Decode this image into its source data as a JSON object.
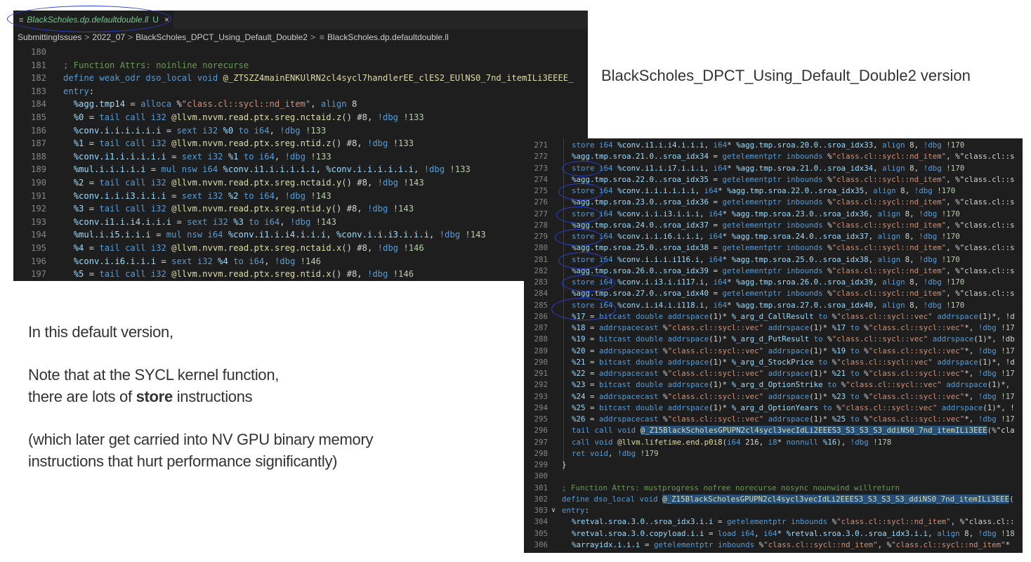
{
  "editor_top": {
    "tab": {
      "filename": "BlackScholes.dp.defaultdouble.ll",
      "status": "U",
      "close": "×"
    },
    "breadcrumb": [
      "SubmittingIssues",
      "2022_07",
      "BlackScholes_DPCT_Using_Default_Double2",
      "BlackScholes.dp.defaultdouble.ll"
    ],
    "lines": [
      {
        "n": "180",
        "t": ""
      },
      {
        "n": "181",
        "t": "; Function Attrs: noinline norecurse"
      },
      {
        "n": "182",
        "t": "define weak_odr dso_local void @_ZTSZZ4mainENKUlRN2cl4sycl7handlerEE_clES2_EUlNS0_7nd_itemILi3EEEE_"
      },
      {
        "n": "183",
        "t": "entry:"
      },
      {
        "n": "184",
        "t": "  %agg.tmp14 = alloca %\"class.cl::sycl::nd_item\", align 8"
      },
      {
        "n": "185",
        "t": "  %0 = tail call i32 @llvm.nvvm.read.ptx.sreg.nctaid.z() #8, !dbg !133"
      },
      {
        "n": "186",
        "t": "  %conv.i.i.i.i.i.i = sext i32 %0 to i64, !dbg !133"
      },
      {
        "n": "187",
        "t": "  %1 = tail call i32 @llvm.nvvm.read.ptx.sreg.ntid.z() #8, !dbg !133"
      },
      {
        "n": "188",
        "t": "  %conv.i1.i.i.i.i.i = sext i32 %1 to i64, !dbg !133"
      },
      {
        "n": "189",
        "t": "  %mul.i.i.i.i.i = mul nsw i64 %conv.i1.i.i.i.i.i, %conv.i.i.i.i.i.i, !dbg !133"
      },
      {
        "n": "190",
        "t": "  %2 = tail call i32 @llvm.nvvm.read.ptx.sreg.nctaid.y() #8, !dbg !143"
      },
      {
        "n": "191",
        "t": "  %conv.i.i.i3.i.i.i = sext i32 %2 to i64, !dbg !143"
      },
      {
        "n": "192",
        "t": "  %3 = tail call i32 @llvm.nvvm.read.ptx.sreg.ntid.y() #8, !dbg !143"
      },
      {
        "n": "193",
        "t": "  %conv.i1.i.i4.i.i.i = sext i32 %3 to i64, !dbg !143"
      },
      {
        "n": "194",
        "t": "  %mul.i.i5.i.i.i = mul nsw i64 %conv.i1.i.i4.i.i.i, %conv.i.i.i3.i.i.i, !dbg !143"
      },
      {
        "n": "195",
        "t": "  %4 = tail call i32 @llvm.nvvm.read.ptx.sreg.nctaid.x() #8, !dbg !146"
      },
      {
        "n": "196",
        "t": "  %conv.i.i6.i.i.i = sext i32 %4 to i64, !dbg !146"
      },
      {
        "n": "197",
        "t": "  %5 = tail call i32 @llvm.nvvm.read.ptx.sreg.ntid.x() #8, !dbg !146"
      }
    ]
  },
  "version_label": "BlackScholes_DPCT_Using_Default_Double2 version",
  "description": {
    "line1": "In this default version,",
    "line2": "Note that at the SYCL kernel function,",
    "line3_pre": "there are lots of ",
    "line3_bold": "store",
    "line3_post": " instructions",
    "line4": "(which later get carried into NV GPU binary memory",
    "line5": "instructions that hurt performance significantly)"
  },
  "editor_bottom": {
    "lines": [
      {
        "n": "271",
        "t": "  store i64 %conv.i1.i.i4.i.i.i, i64* %agg.tmp.sroa.20.0..sroa_idx33, align 8, !dbg !170"
      },
      {
        "n": "272",
        "t": "  %agg.tmp.sroa.21.0..sroa_idx34 = getelementptr inbounds %\"class.cl::sycl::nd_item\", %\"class.cl::s"
      },
      {
        "n": "273",
        "t": "  store i64 %conv.i1.i.i7.i.i.i, i64* %agg.tmp.sroa.21.0..sroa_idx34, align 8, !dbg !170"
      },
      {
        "n": "274",
        "t": "  %agg.tmp.sroa.22.0..sroa_idx35 = getelementptr inbounds %\"class.cl::sycl::nd_item\", %\"class.cl::s"
      },
      {
        "n": "275",
        "t": "  store i64 %conv.i.i.i.i.i.i, i64* %agg.tmp.sroa.22.0..sroa_idx35, align 8, !dbg !170"
      },
      {
        "n": "276",
        "t": "  %agg.tmp.sroa.23.0..sroa_idx36 = getelementptr inbounds %\"class.cl::sycl::nd_item\", %\"class.cl::s"
      },
      {
        "n": "277",
        "t": "  store i64 %conv.i.i.i3.i.i.i, i64* %agg.tmp.sroa.23.0..sroa_idx36, align 8, !dbg !170"
      },
      {
        "n": "278",
        "t": "  %agg.tmp.sroa.24.0..sroa_idx37 = getelementptr inbounds %\"class.cl::sycl::nd_item\", %\"class.cl::s"
      },
      {
        "n": "279",
        "t": "  store i64 %conv.i.i.i6.i.i.i, i64* %agg.tmp.sroa.24.0..sroa_idx37, align 8, !dbg !170"
      },
      {
        "n": "280",
        "t": "  %agg.tmp.sroa.25.0..sroa_idx38 = getelementptr inbounds %\"class.cl::sycl::nd_item\", %\"class.cl::s"
      },
      {
        "n": "281",
        "t": "  store i64 %conv.i.i.i.i116.i, i64* %agg.tmp.sroa.25.0..sroa_idx38, align 8, !dbg !170"
      },
      {
        "n": "282",
        "t": "  %agg.tmp.sroa.26.0..sroa_idx39 = getelementptr inbounds %\"class.cl::sycl::nd_item\", %\"class.cl::s"
      },
      {
        "n": "283",
        "t": "  store i64 %conv.i.i3.i.i117.i, i64* %agg.tmp.sroa.26.0..sroa_idx39, align 8, !dbg !170"
      },
      {
        "n": "284",
        "t": "  %agg.tmp.sroa.27.0..sroa_idx40 = getelementptr inbounds %\"class.cl::sycl::nd_item\", %\"class.cl::s"
      },
      {
        "n": "285",
        "t": "  store i64 %conv.i.i4.i.i118.i, i64* %agg.tmp.sroa.27.0..sroa_idx40, align 8, !dbg !170"
      },
      {
        "n": "286",
        "t": "  %17 = bitcast double addrspace(1)* %_arg_d_CallResult to %\"class.cl::sycl::vec\" addrspace(1)*, !d"
      },
      {
        "n": "287",
        "t": "  %18 = addrspacecast %\"class.cl::sycl::vec\" addrspace(1)* %17 to %\"class.cl::sycl::vec\"*, !dbg !17"
      },
      {
        "n": "288",
        "t": "  %19 = bitcast double addrspace(1)* %_arg_d_PutResult to %\"class.cl::sycl::vec\" addrspace(1)*, !db"
      },
      {
        "n": "289",
        "t": "  %20 = addrspacecast %\"class.cl::sycl::vec\" addrspace(1)* %19 to %\"class.cl::sycl::vec\"*, !dbg !17"
      },
      {
        "n": "290",
        "t": "  %21 = bitcast double addrspace(1)* %_arg_d_StockPrice to %\"class.cl::sycl::vec\" addrspace(1)*, !d"
      },
      {
        "n": "291",
        "t": "  %22 = addrspacecast %\"class.cl::sycl::vec\" addrspace(1)* %21 to %\"class.cl::sycl::vec\"*, !dbg !17"
      },
      {
        "n": "292",
        "t": "  %23 = bitcast double addrspace(1)* %_arg_d_OptionStrike to %\"class.cl::sycl::vec\" addrspace(1)*,"
      },
      {
        "n": "293",
        "t": "  %24 = addrspacecast %\"class.cl::sycl::vec\" addrspace(1)* %23 to %\"class.cl::sycl::vec\"*, !dbg !17"
      },
      {
        "n": "294",
        "t": "  %25 = bitcast double addrspace(1)* %_arg_d_OptionYears to %\"class.cl::sycl::vec\" addrspace(1)*, !"
      },
      {
        "n": "295",
        "t": "  %26 = addrspacecast %\"class.cl::sycl::vec\" addrspace(1)* %25 to %\"class.cl::sycl::vec\"*, !dbg !17"
      },
      {
        "n": "296",
        "t": "  tail call void @_Z15BlackScholesGPUPN2cl4sycl3vecIdLi2EEES3_S3_S3_S3_ddiNS0_7nd_itemILi3EEE(%\"cla"
      },
      {
        "n": "297",
        "t": "  call void @llvm.lifetime.end.p0i8(i64 216, i8* nonnull %16), !dbg !178"
      },
      {
        "n": "298",
        "t": "  ret void, !dbg !179"
      },
      {
        "n": "299",
        "t": "}"
      },
      {
        "n": "300",
        "t": ""
      },
      {
        "n": "301",
        "t": "; Function Attrs: mustprogress nofree norecurse nosync nounwind willreturn"
      },
      {
        "n": "302",
        "t": "define dso_local void @_Z15BlackScholesGPUPN2cl4sycl3vecIdLi2EEES3_S3_S3_S3_ddiNS0_7nd_itemILi3EEE("
      },
      {
        "n": "303",
        "t": "entry:"
      },
      {
        "n": "304",
        "t": "  %retval.sroa.3.0..sroa_idx3.i.i = getelementptr inbounds %\"class.cl::sycl::nd_item\", %\"class.cl::"
      },
      {
        "n": "305",
        "t": "  %retval.sroa.3.0.copyload.i.i = load i64, i64* %retval.sroa.3.0..sroa_idx3.i.i, align 8, !dbg !18"
      },
      {
        "n": "306",
        "t": "  %arrayidx.i.i.i = getelementptr inbounds %\"class.cl::sycl::nd_item\", %\"class.cl::sycl::nd_item\"*"
      }
    ]
  },
  "colors": {
    "accent_annotation": "#2a3fd6",
    "editor_bg": "#1e1e1e",
    "modified_tab": "#73c991"
  },
  "icon_names": [
    "file-icon",
    "close-icon",
    "chevron-right-icon",
    "chevron-down-icon"
  ]
}
